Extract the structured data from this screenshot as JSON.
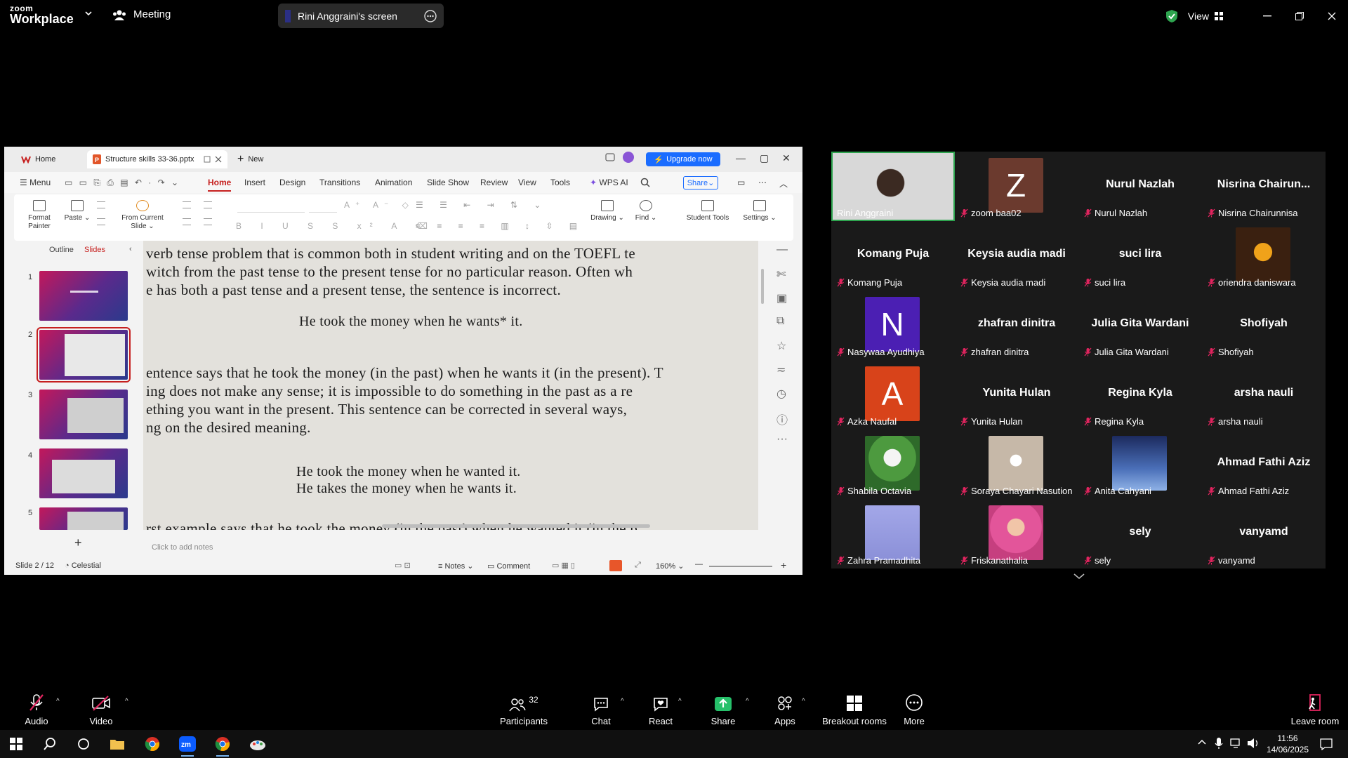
{
  "zoom": {
    "logo_line1": "zoom",
    "logo_line2": "Workplace",
    "meeting_label": "Meeting",
    "screen_share_label": "Rini Anggraini's screen",
    "view_label": "View"
  },
  "wps": {
    "tab_home": "Home",
    "tab_doc": "Structure skills 33-36.pptx",
    "tab_new": "New",
    "upgrade": "Upgrade now",
    "menu": [
      "Menu",
      "Home",
      "Insert",
      "Design",
      "Transitions",
      "Animation",
      "Slide Show",
      "Review",
      "View",
      "Tools",
      "WPS AI"
    ],
    "share": "Share",
    "ribbon": {
      "format_painter": "Format Painter",
      "paste": "Paste",
      "from_current_slide": "From Current Slide",
      "drawing": "Drawing",
      "find": "Find",
      "student_tools": "Student Tools",
      "settings": "Settings"
    },
    "panel_tabs": [
      "Outline",
      "Slides"
    ],
    "thumb_numbers": [
      "1",
      "2",
      "3",
      "4",
      "5"
    ],
    "notes_placeholder": "Click to add notes",
    "status": {
      "slide": "Slide 2 / 12",
      "theme": "Celestial",
      "notes": "Notes",
      "comment": "Comment",
      "zoom": "160%"
    },
    "slide_lines": [
      "verb tense problem that is common both in student writing and on the TOEFL te",
      "witch from the past tense to the present tense for no particular reason. Often wh",
      "e has both a past tense and a present tense, the sentence is incorrect.",
      "He took the money when he wants* it.",
      "entence says that he took the money (in the past) when he wants it (in the present). T",
      "ing does not make any sense; it is impossible to do something in the past as a re",
      "ething you want in the present. This sentence can be corrected in several ways,",
      "ng on the desired meaning.",
      "He took the money when he wanted it.",
      "He takes the money when he wants it.",
      "rst example says that he took the money (in the past) when he wanted it (in the p"
    ]
  },
  "participants": [
    {
      "big": "",
      "name": "Rini Anggraini",
      "kind": "video"
    },
    {
      "big": "Z",
      "name": "zoom baa02",
      "kind": "letter",
      "color": "#6b3a2e"
    },
    {
      "big": "Nurul Nazlah",
      "name": "Nurul Nazlah",
      "kind": "text"
    },
    {
      "big": "Nisrina  Chairun...",
      "name": "Nisrina Chairunnisa",
      "kind": "text"
    },
    {
      "big": "Komang Puja",
      "name": "Komang Puja",
      "kind": "text"
    },
    {
      "big": "Keysia audia madi",
      "name": "Keysia audia madi",
      "kind": "text"
    },
    {
      "big": "suci lira",
      "name": "suci lira",
      "kind": "text"
    },
    {
      "big": "",
      "name": "oriendra daniswara",
      "kind": "photo-orange"
    },
    {
      "big": "N",
      "name": "Nasywaa Ayudhiya",
      "kind": "letter",
      "color": "#4b1fb3"
    },
    {
      "big": "zhafran dinitra",
      "name": "zhafran dinitra",
      "kind": "text"
    },
    {
      "big": "Julia Gita Wardani",
      "name": "Julia Gita Wardani",
      "kind": "text"
    },
    {
      "big": "Shofiyah",
      "name": "Shofiyah",
      "kind": "text"
    },
    {
      "big": "A",
      "name": "Azka Naufal",
      "kind": "letter",
      "color": "#d8431a"
    },
    {
      "big": "Yunita Hulan",
      "name": "Yunita Hulan",
      "kind": "text"
    },
    {
      "big": "Regina Kyla",
      "name": "Regina Kyla",
      "kind": "text"
    },
    {
      "big": "arsha nauli",
      "name": "arsha nauli",
      "kind": "text"
    },
    {
      "big": "",
      "name": "Shabila Octavia",
      "kind": "photo-cartoon"
    },
    {
      "big": "",
      "name": "Soraya Chayari Nasution",
      "kind": "photo-beige"
    },
    {
      "big": "",
      "name": "Anita Cahyani",
      "kind": "photo-blue"
    },
    {
      "big": "Ahmad Fathi Aziz",
      "name": "Ahmad Fathi Aziz",
      "kind": "text"
    },
    {
      "big": "",
      "name": "Zahra Pramadhita",
      "kind": "photo-lavender"
    },
    {
      "big": "",
      "name": "Friskanathalia",
      "kind": "photo-pink"
    },
    {
      "big": "sely",
      "name": "sely",
      "kind": "text"
    },
    {
      "big": "vanyamd",
      "name": "vanyamd",
      "kind": "text"
    }
  ],
  "toolbar": {
    "audio": "Audio",
    "video": "Video",
    "participants_count": "32",
    "participants": "Participants",
    "chat": "Chat",
    "react": "React",
    "share": "Share",
    "apps": "Apps",
    "breakout": "Breakout rooms",
    "more": "More",
    "leave": "Leave room"
  },
  "taskbar": {
    "time": "11:56",
    "date": "14/06/2025"
  },
  "colors": {
    "accent_red": "#c6201f",
    "wps_blue": "#1a6cff",
    "active_speaker": "#2ea44f",
    "muted": "#e0245e"
  }
}
